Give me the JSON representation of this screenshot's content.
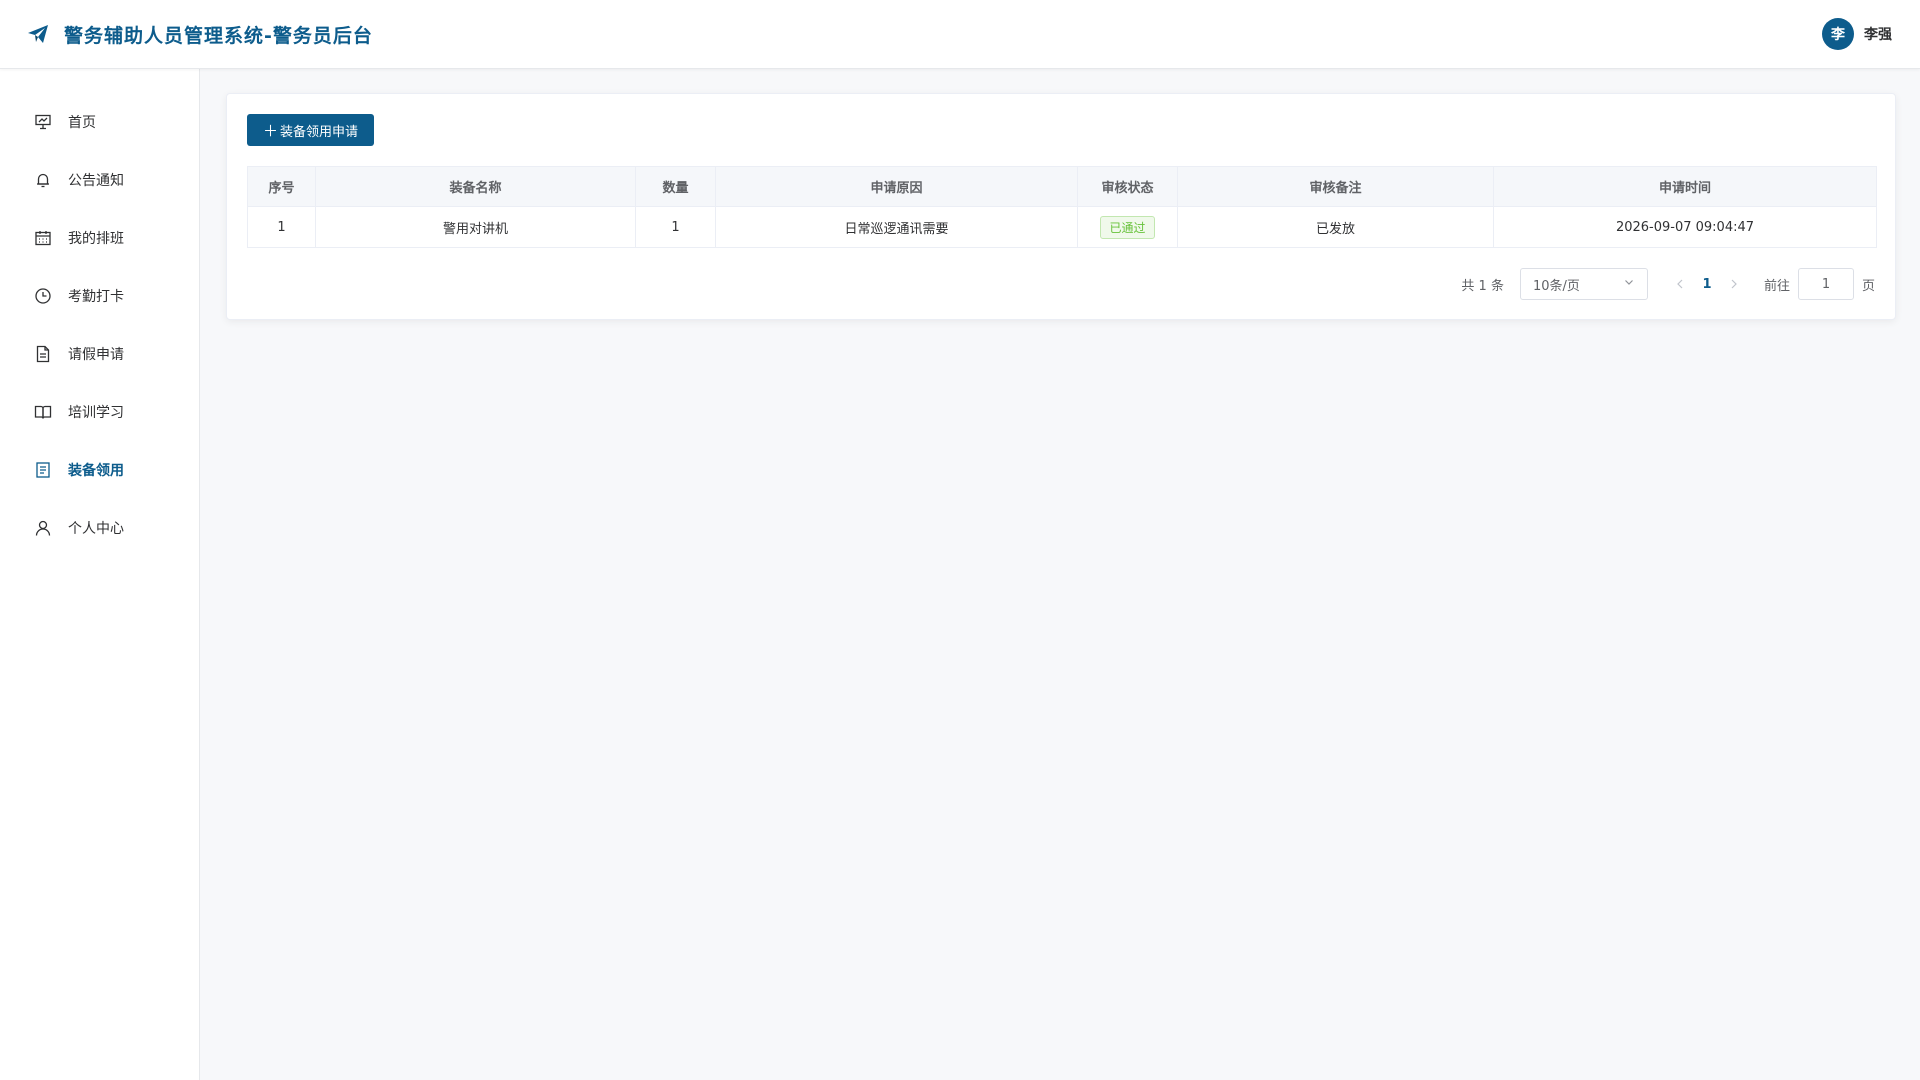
{
  "header": {
    "title": "警务辅助人员管理系统-警务员后台",
    "user": {
      "avatar_char": "李",
      "name": "李强"
    }
  },
  "sidebar": {
    "items": [
      {
        "label": "首页",
        "icon": "presentation-icon",
        "active": false
      },
      {
        "label": "公告通知",
        "icon": "bell-icon",
        "active": false
      },
      {
        "label": "我的排班",
        "icon": "calendar-icon",
        "active": false
      },
      {
        "label": "考勤打卡",
        "icon": "clock-icon",
        "active": false
      },
      {
        "label": "请假申请",
        "icon": "document-icon",
        "active": false
      },
      {
        "label": "培训学习",
        "icon": "book-icon",
        "active": false
      },
      {
        "label": "装备领用",
        "icon": "list-icon",
        "active": true
      },
      {
        "label": "个人中心",
        "icon": "user-icon",
        "active": false
      }
    ]
  },
  "toolbar": {
    "add_label": "装备领用申请"
  },
  "table": {
    "columns": [
      "序号",
      "装备名称",
      "数量",
      "申请原因",
      "审核状态",
      "审核备注",
      "申请时间"
    ],
    "rows": [
      {
        "index": "1",
        "name": "警用对讲机",
        "qty": "1",
        "reason": "日常巡逻通讯需要",
        "status": "已通过",
        "remark": "已发放",
        "time": "2026-09-07 09:04:47"
      }
    ]
  },
  "pagination": {
    "total_text": "共 1 条",
    "page_size": "10条/页",
    "current_page": "1",
    "goto_label": "前往",
    "goto_value": "1",
    "goto_suffix": "页"
  },
  "colors": {
    "primary": "#0d5c8c",
    "success": "#67c23a",
    "background": "#f7f8fa"
  }
}
